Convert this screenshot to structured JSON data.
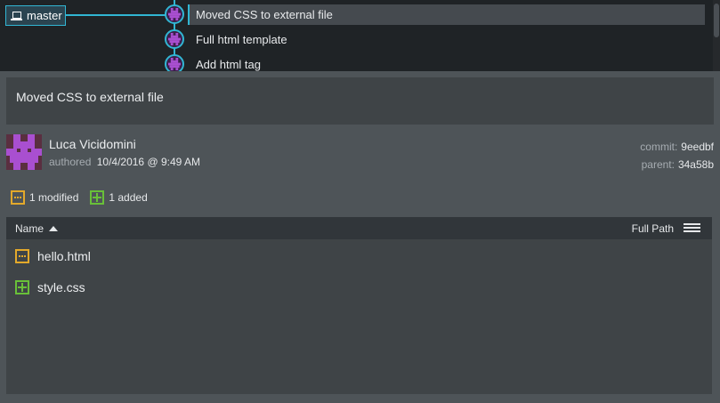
{
  "graph": {
    "branch": {
      "name": "master",
      "icon": "laptop-icon"
    },
    "commits": [
      {
        "message": "Moved CSS to external file",
        "selected": true
      },
      {
        "message": "Full html template",
        "selected": false
      },
      {
        "message": "Add html tag",
        "selected": false
      }
    ],
    "accent_color": "#31b6d3"
  },
  "detail": {
    "message": "Moved CSS to external file",
    "author": {
      "name": "Luca Vicidomini",
      "authored_label": "authored",
      "date": "10/4/2016 @ 9:49 AM"
    },
    "commit_label": "commit:",
    "commit_sha": "9eedbf",
    "parent_label": "parent:",
    "parent_sha": "34a58b",
    "summary": {
      "modified": "1 modified",
      "added": "1 added"
    },
    "file_list": {
      "name_header": "Name",
      "path_toggle": "Full Path",
      "files": [
        {
          "name": "hello.html",
          "status": "modified",
          "icon": "modified-file-icon"
        },
        {
          "name": "style.css",
          "status": "added",
          "icon": "added-file-icon"
        }
      ]
    }
  },
  "colors": {
    "modified": "#e3a92b",
    "added": "#69c039",
    "avatar": "#a94fd0"
  }
}
